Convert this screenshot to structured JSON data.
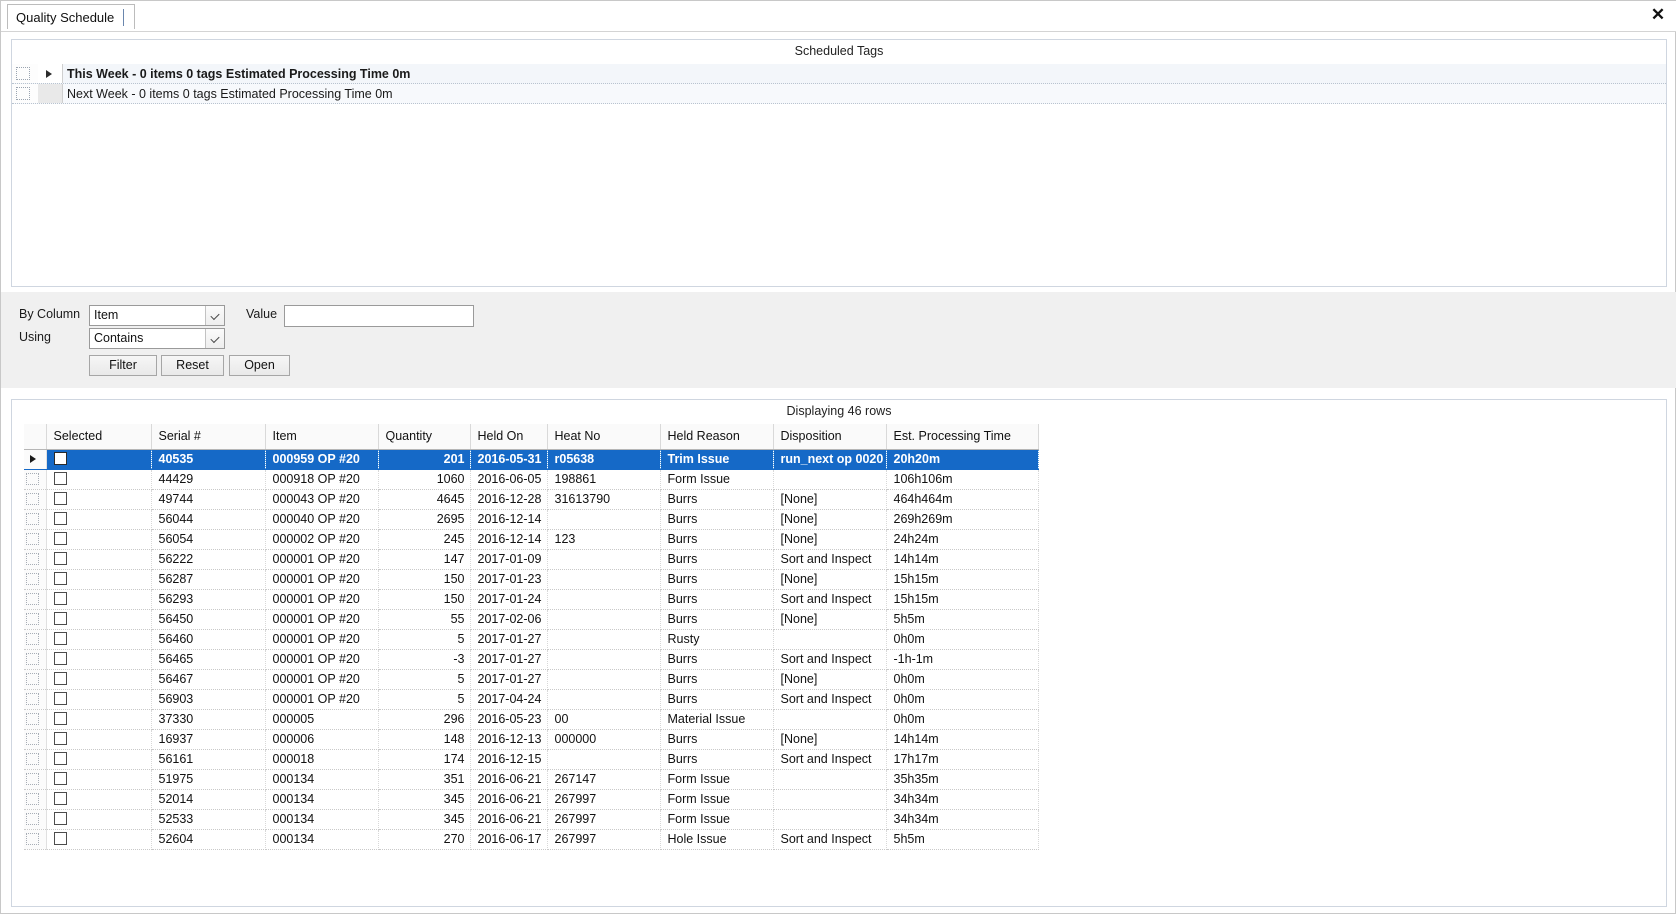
{
  "window": {
    "tab_label": "Quality Schedule",
    "close_icon": "close-icon"
  },
  "scheduled_tags": {
    "title": "Scheduled Tags",
    "rows": [
      {
        "label": "This Week - 0 items 0 tags  Estimated Processing Time 0m",
        "expander_icon": "triangle-right-icon"
      },
      {
        "label": "Next Week - 0 items 0 tags  Estimated Processing Time 0m",
        "expander_icon": "none"
      }
    ]
  },
  "filter": {
    "by_column_label": "By Column",
    "using_label": "Using",
    "value_label": "Value",
    "column_selected": "Item",
    "column_options": [
      "Item"
    ],
    "using_selected": "Contains",
    "using_options": [
      "Contains"
    ],
    "value_text": "",
    "value_placeholder": "",
    "buttons": {
      "filter": "Filter",
      "reset": "Reset",
      "open": "Open"
    }
  },
  "grid": {
    "caption": "Displaying 46 rows",
    "columns": [
      "Selected",
      "Serial #",
      "Item",
      "Quantity",
      "Held On",
      "Heat No",
      "Held Reason",
      "Disposition",
      "Est. Processing Time"
    ],
    "rows": [
      {
        "selected": true,
        "serial": "40535",
        "item": "000959 OP #20",
        "quantity": "201",
        "held_on": "2016-05-31",
        "heat_no": "r05638",
        "held_reason": "Trim Issue",
        "disposition": "run_next op 0020",
        "est_time": "20h20m"
      },
      {
        "selected": false,
        "serial": "44429",
        "item": "000918 OP #20",
        "quantity": "1060",
        "held_on": "2016-06-05",
        "heat_no": "198861",
        "held_reason": "Form Issue",
        "disposition": "",
        "est_time": "106h106m"
      },
      {
        "selected": false,
        "serial": "49744",
        "item": "000043 OP #20",
        "quantity": "4645",
        "held_on": "2016-12-28",
        "heat_no": "31613790",
        "held_reason": "Burrs",
        "disposition": "[None]",
        "est_time": "464h464m"
      },
      {
        "selected": false,
        "serial": "56044",
        "item": "000040 OP #20",
        "quantity": "2695",
        "held_on": "2016-12-14",
        "heat_no": "",
        "held_reason": "Burrs",
        "disposition": "[None]",
        "est_time": "269h269m"
      },
      {
        "selected": false,
        "serial": "56054",
        "item": "000002 OP #20",
        "quantity": "245",
        "held_on": "2016-12-14",
        "heat_no": "123",
        "held_reason": "Burrs",
        "disposition": "[None]",
        "est_time": "24h24m"
      },
      {
        "selected": false,
        "serial": "56222",
        "item": "000001 OP #20",
        "quantity": "147",
        "held_on": "2017-01-09",
        "heat_no": "",
        "held_reason": "Burrs",
        "disposition": "Sort and Inspect",
        "est_time": "14h14m"
      },
      {
        "selected": false,
        "serial": "56287",
        "item": "000001 OP #20",
        "quantity": "150",
        "held_on": "2017-01-23",
        "heat_no": "",
        "held_reason": "Burrs",
        "disposition": "[None]",
        "est_time": "15h15m"
      },
      {
        "selected": false,
        "serial": "56293",
        "item": "000001 OP #20",
        "quantity": "150",
        "held_on": "2017-01-24",
        "heat_no": "",
        "held_reason": "Burrs",
        "disposition": "Sort and Inspect",
        "est_time": "15h15m"
      },
      {
        "selected": false,
        "serial": "56450",
        "item": "000001 OP #20",
        "quantity": "55",
        "held_on": "2017-02-06",
        "heat_no": "",
        "held_reason": "Burrs",
        "disposition": "[None]",
        "est_time": "5h5m"
      },
      {
        "selected": false,
        "serial": "56460",
        "item": "000001 OP #20",
        "quantity": "5",
        "held_on": "2017-01-27",
        "heat_no": "",
        "held_reason": "Rusty",
        "disposition": "",
        "est_time": "0h0m"
      },
      {
        "selected": false,
        "serial": "56465",
        "item": "000001 OP #20",
        "quantity": "-3",
        "held_on": "2017-01-27",
        "heat_no": "",
        "held_reason": "Burrs",
        "disposition": "Sort and Inspect",
        "est_time": "-1h-1m"
      },
      {
        "selected": false,
        "serial": "56467",
        "item": "000001 OP #20",
        "quantity": "5",
        "held_on": "2017-01-27",
        "heat_no": "",
        "held_reason": "Burrs",
        "disposition": "[None]",
        "est_time": "0h0m"
      },
      {
        "selected": false,
        "serial": "56903",
        "item": "000001 OP #20",
        "quantity": "5",
        "held_on": "2017-04-24",
        "heat_no": "",
        "held_reason": "Burrs",
        "disposition": "Sort and Inspect",
        "est_time": "0h0m"
      },
      {
        "selected": false,
        "serial": "37330",
        "item": "000005",
        "quantity": "296",
        "held_on": "2016-05-23",
        "heat_no": "00",
        "held_reason": "Material Issue",
        "disposition": "",
        "est_time": "0h0m"
      },
      {
        "selected": false,
        "serial": "16937",
        "item": "000006",
        "quantity": "148",
        "held_on": "2016-12-13",
        "heat_no": "000000",
        "held_reason": "Burrs",
        "disposition": "[None]",
        "est_time": "14h14m"
      },
      {
        "selected": false,
        "serial": "56161",
        "item": "000018",
        "quantity": "174",
        "held_on": "2016-12-15",
        "heat_no": "",
        "held_reason": "Burrs",
        "disposition": "Sort and Inspect",
        "est_time": "17h17m"
      },
      {
        "selected": false,
        "serial": "51975",
        "item": "000134",
        "quantity": "351",
        "held_on": "2016-06-21",
        "heat_no": "267147",
        "held_reason": "Form Issue",
        "disposition": "",
        "est_time": "35h35m"
      },
      {
        "selected": false,
        "serial": "52014",
        "item": "000134",
        "quantity": "345",
        "held_on": "2016-06-21",
        "heat_no": "267997",
        "held_reason": "Form Issue",
        "disposition": "",
        "est_time": "34h34m"
      },
      {
        "selected": false,
        "serial": "52533",
        "item": "000134",
        "quantity": "345",
        "held_on": "2016-06-21",
        "heat_no": "267997",
        "held_reason": "Form Issue",
        "disposition": "",
        "est_time": "34h34m"
      },
      {
        "selected": false,
        "serial": "52604",
        "item": "000134",
        "quantity": "270",
        "held_on": "2016-06-17",
        "heat_no": "267997",
        "held_reason": "Hole Issue",
        "disposition": "Sort and Inspect",
        "est_time": "5h5m"
      }
    ]
  },
  "colors": {
    "selection_blue": "#1569c7",
    "panel_bg": "#f0f0f0",
    "panel_border": "#cfd6e0"
  }
}
